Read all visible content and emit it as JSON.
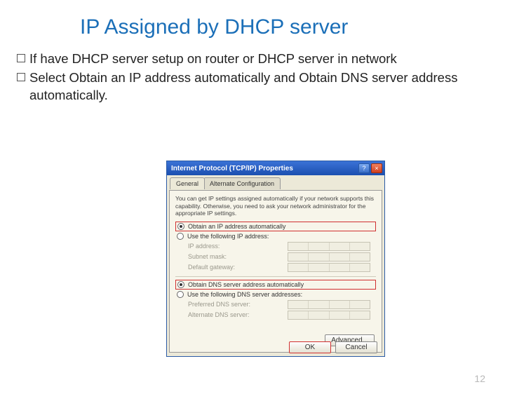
{
  "title": "IP Assigned by DHCP server",
  "bullets": [
    "If have DHCP server setup on router or DHCP server in network",
    "Select Obtain an IP address automatically and Obtain DNS server address automatically."
  ],
  "dialog": {
    "title": "Internet Protocol (TCP/IP) Properties",
    "help": "?",
    "close": "×",
    "tabs": {
      "general": "General",
      "alt": "Alternate Configuration"
    },
    "desc": "You can get IP settings assigned automatically if your network supports this capability. Otherwise, you need to ask your network administrator for the appropriate IP settings.",
    "radio_auto_ip": "Obtain an IP address automatically",
    "radio_manual_ip": "Use the following IP address:",
    "fields_ip": {
      "ip": "IP address:",
      "mask": "Subnet mask:",
      "gw": "Default gateway:"
    },
    "radio_auto_dns": "Obtain DNS server address automatically",
    "radio_manual_dns": "Use the following DNS server addresses:",
    "fields_dns": {
      "pref": "Preferred DNS server:",
      "alt": "Alternate DNS server:"
    },
    "advanced": "Advanced...",
    "ok": "OK",
    "cancel": "Cancel"
  },
  "page_number": "12"
}
